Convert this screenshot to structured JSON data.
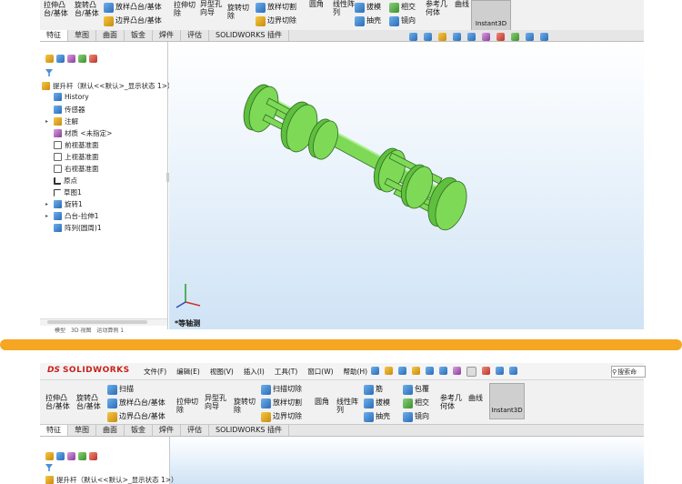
{
  "top": {
    "ribbon": {
      "col1": "拉伸凸\n台/基体",
      "col2": "旋转凸\n台/基体",
      "loft_boss": "放样凸台/基体",
      "boundary_boss": "边界凸台/基体",
      "extrude_cut": "拉伸切\n除",
      "hole_wizard": "异型孔\n向导",
      "revolve_cut": "旋转切\n除",
      "loft_cut": "放样切割",
      "boundary_cut": "边界切除",
      "fillet": "圆角",
      "linear_pattern": "线性阵\n列",
      "draft": "拔模",
      "shell": "抽壳",
      "intersect": "相交",
      "mirror": "镜向",
      "ref_geometry": "参考几\n何体",
      "curves": "曲线",
      "instant3d": "Instant3D"
    },
    "tabs": [
      "特征",
      "草图",
      "曲面",
      "钣金",
      "焊件",
      "评估",
      "SOLIDWORKS 插件"
    ],
    "tree": {
      "root": "提升杆（默认<<默认>_显示状态 1>）",
      "items": [
        "History",
        "传感器",
        "注解",
        "材质 <未指定>",
        "前视基准面",
        "上视基准面",
        "右视基准面",
        "原点",
        "草图1",
        "旋转1",
        "凸台-拉伸1",
        "阵列(圆周)1"
      ]
    },
    "view_label": "*等轴测",
    "bottom_tabs_cut": [
      "模型",
      "3D 视图",
      "运动算例 1"
    ]
  },
  "bottom": {
    "brand": "SOLIDWORKS",
    "menus": [
      "文件(F)",
      "编辑(E)",
      "视图(V)",
      "插入(I)",
      "工具(T)",
      "窗口(W)",
      "帮助(H)"
    ],
    "search_placeholder": "搜索命",
    "ribbon": {
      "col1": "拉伸凸\n台/基体",
      "col2": "旋转凸\n台/基体",
      "sweep": "扫描",
      "loft_boss": "放样凸台/基体",
      "boundary_boss": "边界凸台/基体",
      "extrude_cut": "拉伸切\n除",
      "hole_wizard": "异型孔\n向导",
      "revolve_cut": "旋转切\n除",
      "sweep_cut": "扫描切除",
      "loft_cut": "放样切割",
      "boundary_cut": "边界切除",
      "fillet": "圆角",
      "linear_pattern": "线性阵\n列",
      "rib": "筋",
      "wrap": "包覆",
      "draft": "拔模",
      "intersect": "相交",
      "shell": "抽壳",
      "mirror": "镜向",
      "ref_geometry": "参考几\n何体",
      "curves": "曲线",
      "instant3d": "Instant3D"
    },
    "tabs": [
      "特征",
      "草图",
      "曲面",
      "钣金",
      "焊件",
      "评估",
      "SOLIDWORKS 插件"
    ],
    "tree_root": "提升杆（默认<<默认>_显示状态 1>）"
  },
  "colors": {
    "divider": "#f5a623",
    "model": "#7ed957",
    "model_dark": "#2f6b1f",
    "accent": "#1f5fa8"
  }
}
